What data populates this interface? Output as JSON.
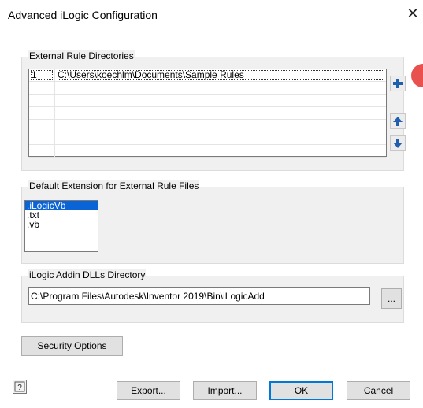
{
  "window": {
    "title": "Advanced iLogic Configuration",
    "close_glyph": "✕"
  },
  "external_rules": {
    "label": "External Rule Directories",
    "rows": [
      {
        "num": "1",
        "path": "C:\\Users\\koechlm\\Documents\\Sample Rules"
      },
      {
        "num": "",
        "path": ""
      },
      {
        "num": "",
        "path": ""
      },
      {
        "num": "",
        "path": ""
      },
      {
        "num": "",
        "path": ""
      },
      {
        "num": "",
        "path": ""
      },
      {
        "num": "",
        "path": ""
      }
    ],
    "icons": [
      "add-icon",
      "move-up-icon",
      "move-down-icon"
    ]
  },
  "default_extension": {
    "label": "Default Extension for External Rule Files",
    "options": [
      ".iLogicVb",
      ".txt",
      ".vb"
    ],
    "selected": ".iLogicVb"
  },
  "addin_dir": {
    "label": "iLogic Addin DLLs Directory",
    "value": "C:\\Program Files\\Autodesk\\Inventor 2019\\Bin\\iLogicAdd",
    "browse_label": "..."
  },
  "security_button": "Security Options",
  "footer": {
    "help_icon": "help-icon",
    "export_label": "Export...",
    "import_label": "Import...",
    "ok_label": "OK",
    "cancel_label": "Cancel"
  },
  "colors": {
    "accent": "#0078d7",
    "selection": "#0a64d6",
    "icon_blue": "#1f5fae",
    "badge": "#e8514d"
  }
}
